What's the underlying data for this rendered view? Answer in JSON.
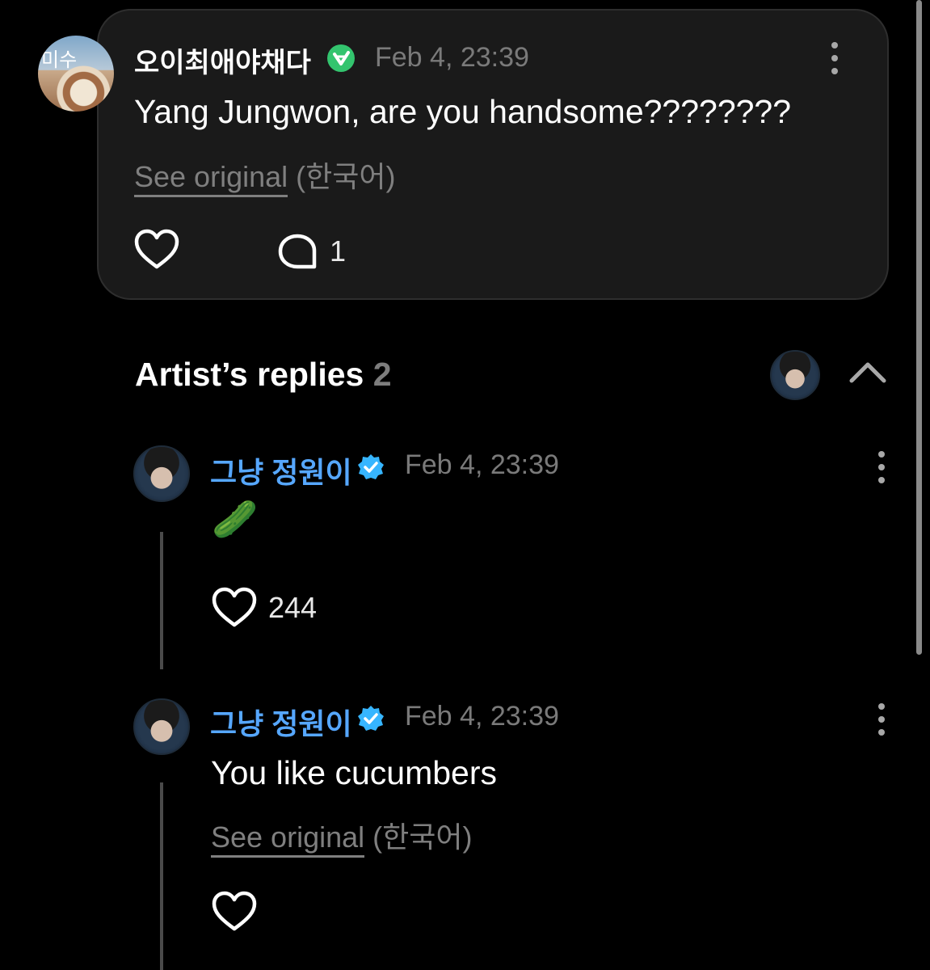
{
  "post": {
    "username": "오이최애야채다",
    "timestamp": "Feb 4, 23:39",
    "avatar_text": "미수",
    "text": "Yang Jungwon, are you handsome????????",
    "see_original": "See original",
    "language": "(한국어)",
    "comment_count": "1"
  },
  "artist_replies": {
    "title": "Artist’s replies",
    "count": "2",
    "replies": [
      {
        "username": "그냥 정원이",
        "timestamp": "Feb 4, 23:39",
        "emoji": "🥒",
        "like_count": "244"
      },
      {
        "username": "그냥 정원이",
        "timestamp": "Feb 4, 23:39",
        "text": "You like cucumbers",
        "see_original": "See original",
        "language": "(한국어)"
      }
    ]
  },
  "colors": {
    "background": "#000000",
    "card": "#1a1a1a",
    "artist_name": "#56a7ff",
    "verified_green": "#33c46e",
    "verified_blue": "#36b5ff"
  }
}
